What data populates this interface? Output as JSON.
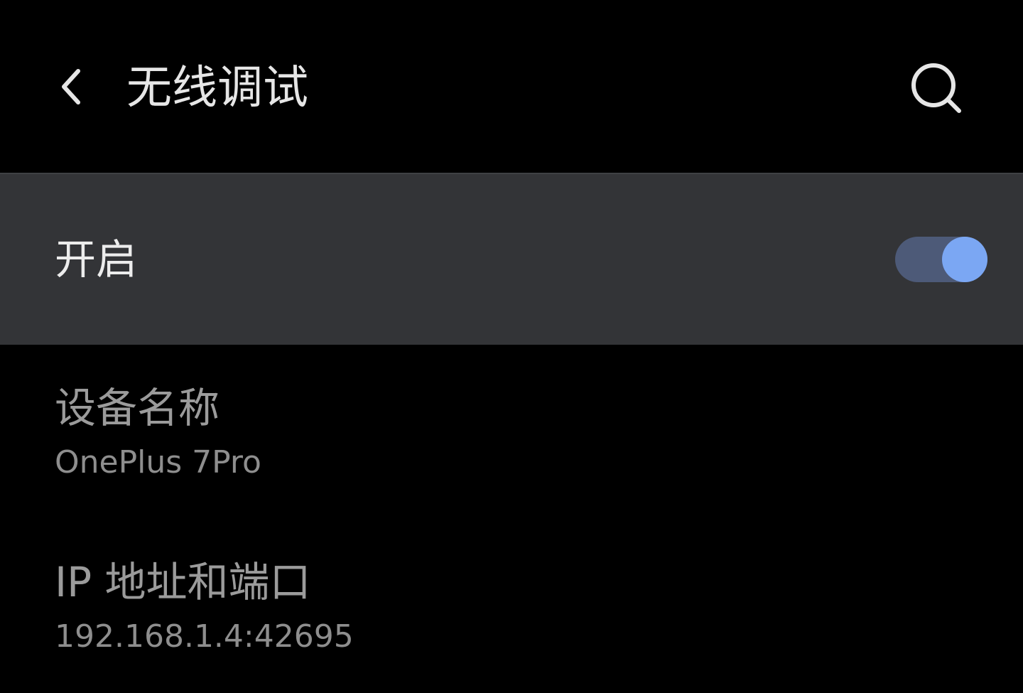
{
  "app_bar": {
    "title": "无线调试",
    "back_icon": "chevron-left-icon",
    "search_icon": "search-icon"
  },
  "master_switch": {
    "label": "开启",
    "checked": true,
    "track_color": "#4d5a78",
    "thumb_color": "#7ba7f3"
  },
  "items": [
    {
      "title": "设备名称",
      "summary": "OnePlus 7Pro"
    },
    {
      "title": "IP 地址和端口",
      "summary": "192.168.1.4:42695"
    }
  ],
  "colors": {
    "background": "#000000",
    "row_background": "#333437"
  }
}
